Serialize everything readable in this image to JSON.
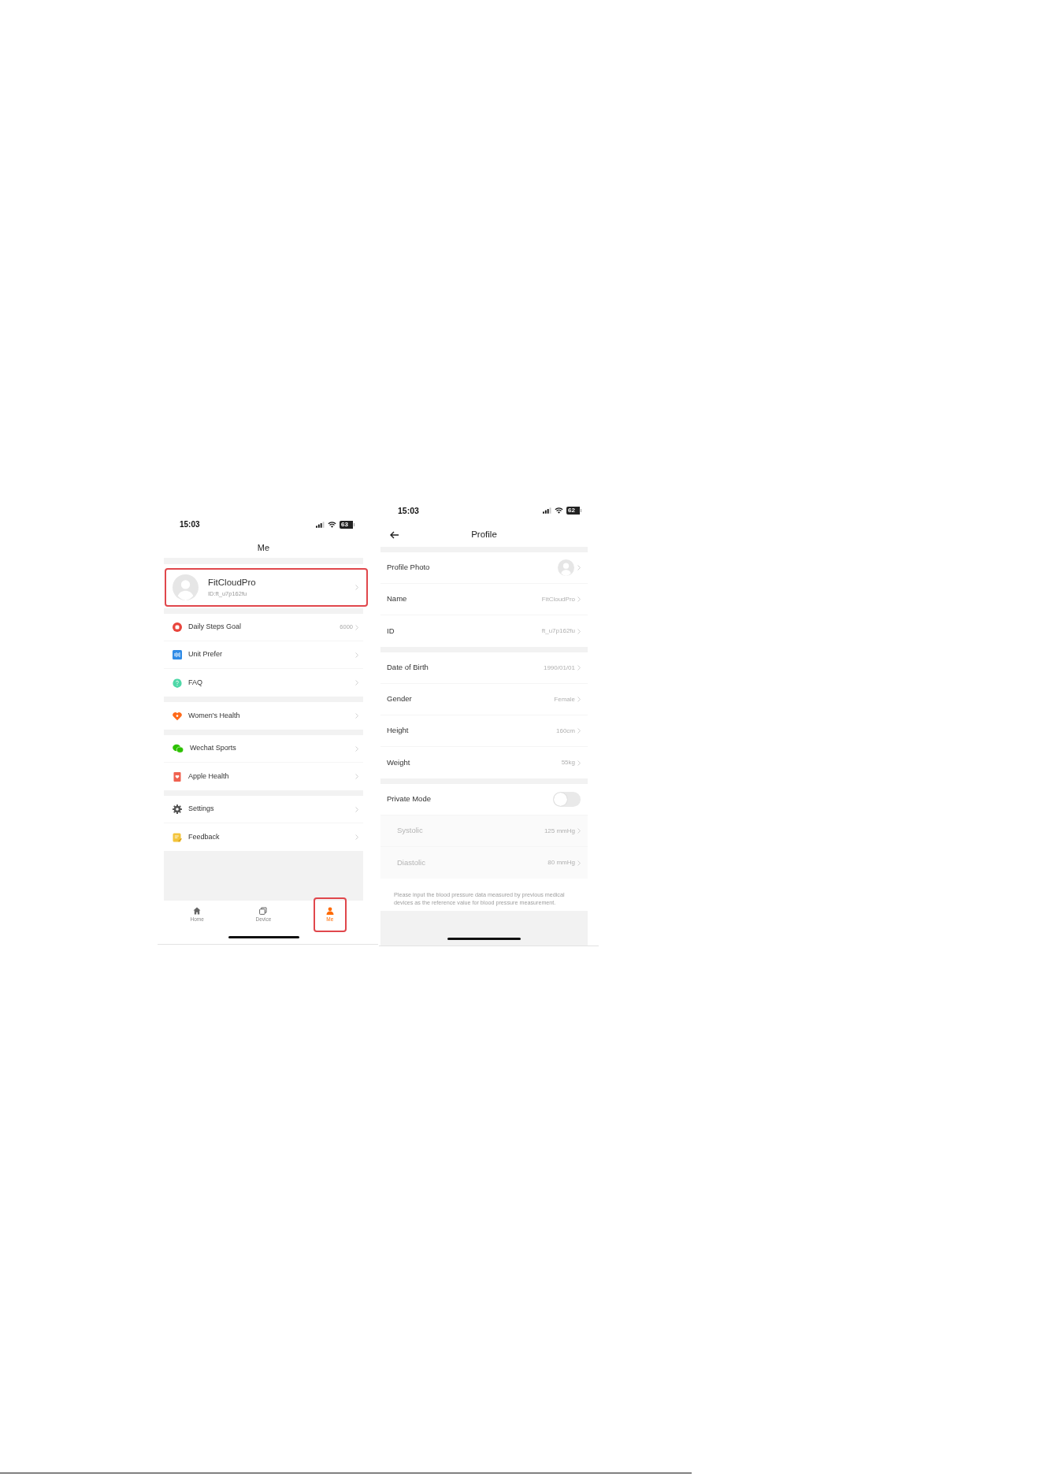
{
  "me_screen": {
    "status_bar": {
      "time": "15:03",
      "battery": "63"
    },
    "title": "Me",
    "profile": {
      "name": "FitCloudPro",
      "id_text": "ID:ft_u7p162fu",
      "highlighted": true
    },
    "menu_sections": [
      {
        "items": [
          {
            "label": "Daily Steps Goal",
            "value": "6000"
          },
          {
            "label": "Unit Prefer"
          },
          {
            "label": "FAQ"
          }
        ]
      },
      {
        "items": [
          {
            "label": "Women's Health"
          }
        ]
      },
      {
        "items": [
          {
            "label": "Wechat Sports"
          },
          {
            "label": "Apple Health"
          }
        ]
      },
      {
        "items": [
          {
            "label": "Settings"
          },
          {
            "label": "Feedback"
          }
        ]
      }
    ],
    "tab_bar": [
      {
        "label": "Home",
        "selected": false,
        "highlighted": false
      },
      {
        "label": "Device",
        "selected": false,
        "highlighted": false
      },
      {
        "label": "Me",
        "selected": true,
        "highlighted": true
      }
    ]
  },
  "profile_screen": {
    "status_bar": {
      "time": "15:03",
      "battery": "62"
    },
    "title": "Profile",
    "sections": [
      {
        "rows": [
          {
            "kind": "photo",
            "label": "Profile Photo"
          },
          {
            "kind": "value",
            "label": "Name",
            "value": "FitCloudPro"
          },
          {
            "kind": "value",
            "label": "ID",
            "value": "ft_u7p162fu"
          }
        ]
      },
      {
        "rows": [
          {
            "kind": "value",
            "label": "Date of Birth",
            "value": "1990/01/01"
          },
          {
            "kind": "value",
            "label": "Gender",
            "value": "Female"
          },
          {
            "kind": "value",
            "label": "Height",
            "value": "160cm"
          },
          {
            "kind": "value",
            "label": "Weight",
            "value": "55kg"
          }
        ]
      },
      {
        "rows": [
          {
            "kind": "toggle",
            "label": "Private Mode",
            "on": false,
            "disabled": false
          },
          {
            "kind": "value",
            "label": "Systolic",
            "value": "125 mmHg",
            "disabled": true
          },
          {
            "kind": "value",
            "label": "Diastolic",
            "value": "80 mmHg",
            "disabled": true
          }
        ],
        "note": "Please input the blood pressure data measured by previous medical devices as the reference value for blood pressure measurement."
      }
    ]
  }
}
